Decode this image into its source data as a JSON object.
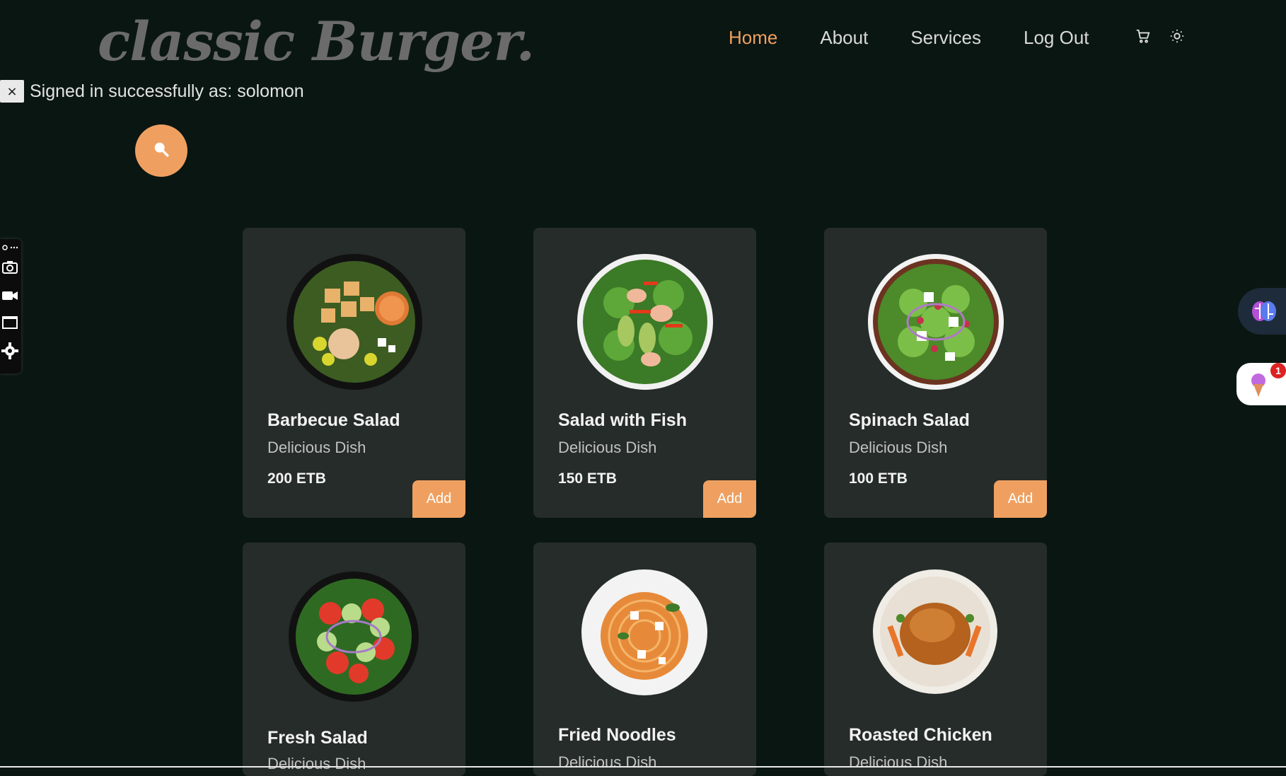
{
  "brand": {
    "logo_text": "classic Burger."
  },
  "nav": {
    "items": [
      {
        "label": "Home",
        "active": true
      },
      {
        "label": "About",
        "active": false
      },
      {
        "label": "Services",
        "active": false
      },
      {
        "label": "Log Out",
        "active": false
      }
    ],
    "icons": [
      "cart-icon",
      "sun-icon"
    ]
  },
  "flash": {
    "close_label": "×",
    "message": "Signed in successfully as: solomon"
  },
  "search": {
    "icon": "search-icon"
  },
  "side_toolbar": {
    "icons": [
      "link-icon",
      "more-icon",
      "camera-icon",
      "video-icon",
      "window-icon",
      "gear-icon"
    ]
  },
  "menu": {
    "items": [
      {
        "name": "Barbecue Salad",
        "subtitle": "Delicious Dish",
        "price": "200 ETB",
        "add_label": "Add"
      },
      {
        "name": "Salad with Fish",
        "subtitle": "Delicious Dish",
        "price": "150 ETB",
        "add_label": "Add"
      },
      {
        "name": "Spinach Salad",
        "subtitle": "Delicious Dish",
        "price": "100 ETB",
        "add_label": "Add"
      },
      {
        "name": "Fresh Salad",
        "subtitle": "Delicious Dish"
      },
      {
        "name": "Fried Noodles",
        "subtitle": "Delicious Dish"
      },
      {
        "name": "Roasted Chicken",
        "subtitle": "Delicious Dish"
      }
    ]
  },
  "floating": {
    "notification_count": "1"
  },
  "colors": {
    "accent": "#efa060",
    "background": "#0a1612",
    "card": "#252c29"
  }
}
